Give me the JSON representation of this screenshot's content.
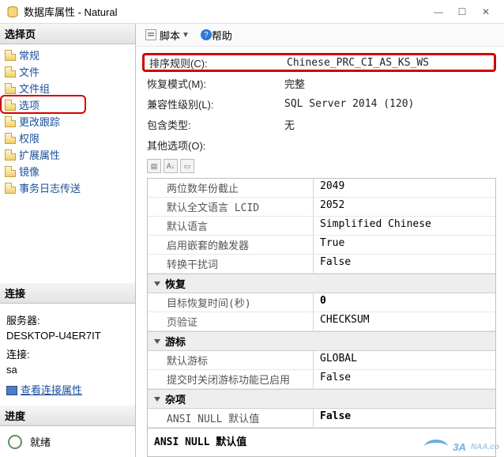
{
  "window": {
    "title": "数据库属性 - Natural",
    "minimize": "—",
    "maximize": "☐",
    "close": "✕"
  },
  "left": {
    "select_page": "选择页",
    "items": [
      {
        "label": "常规"
      },
      {
        "label": "文件"
      },
      {
        "label": "文件组"
      },
      {
        "label": "选项",
        "boxed": true
      },
      {
        "label": "更改跟踪"
      },
      {
        "label": "权限"
      },
      {
        "label": "扩展属性"
      },
      {
        "label": "镜像"
      },
      {
        "label": "事务日志传送"
      }
    ],
    "connection": {
      "header": "连接",
      "server_label": "服务器:",
      "server_val": "DESKTOP-U4ER7IT",
      "conn_label": "连接:",
      "conn_val": "sa",
      "view_props": "查看连接属性"
    },
    "progress": {
      "header": "进度",
      "status": "就绪"
    }
  },
  "toolbar": {
    "script": "脚本",
    "help": "帮助"
  },
  "form": {
    "collation_label": "排序规则(C):",
    "collation_val": "Chinese_PRC_CI_AS_KS_WS",
    "recovery_label": "恢复模式(M):",
    "recovery_val": "完整",
    "compat_label": "兼容性级别(L):",
    "compat_val": "SQL Server 2014 (120)",
    "contain_label": "包含类型:",
    "contain_val": "无",
    "other_label": "其他选项(O):"
  },
  "prop_groups": [
    {
      "rows": [
        {
          "k": "两位数年份截止",
          "v": "2049"
        },
        {
          "k": "默认全文语言 LCID",
          "v": "2052"
        },
        {
          "k": "默认语言",
          "v": "Simplified Chinese"
        },
        {
          "k": "启用嵌套的触发器",
          "v": "True"
        },
        {
          "k": "转换干扰词",
          "v": "False"
        }
      ]
    },
    {
      "title": "恢复",
      "rows": [
        {
          "k": "目标恢复时间(秒)",
          "v": "0",
          "bold": true
        },
        {
          "k": "页验证",
          "v": "CHECKSUM"
        }
      ]
    },
    {
      "title": "游标",
      "rows": [
        {
          "k": "默认游标",
          "v": "GLOBAL"
        },
        {
          "k": "提交时关闭游标功能已启用",
          "v": "False"
        }
      ]
    },
    {
      "title": "杂项",
      "rows": [
        {
          "k": "ANSI NULL 默认值",
          "v": "False",
          "bold": true
        }
      ]
    }
  ],
  "desc": "ANSI NULL 默认值",
  "watermark": {
    "brand": "3A",
    "sub": "NAA.co"
  }
}
